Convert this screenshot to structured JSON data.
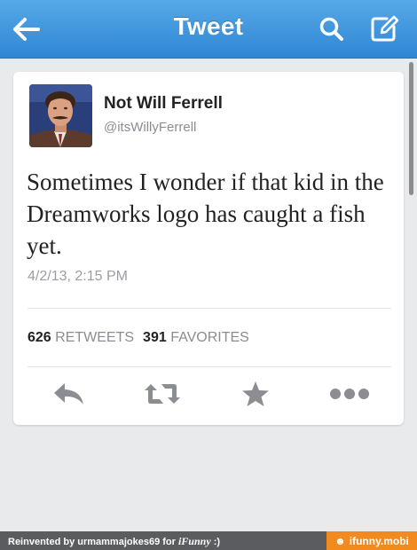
{
  "navbar": {
    "title": "Tweet",
    "back_icon": "back-arrow-icon",
    "search_icon": "search-icon",
    "compose_icon": "compose-icon"
  },
  "tweet": {
    "author_name": "Not Will Ferrell",
    "author_handle": "@itsWillyFerrell",
    "text": "Sometimes I wonder if that kid in the Dreamworks logo has caught a fish yet.",
    "timestamp": "4/2/13, 2:15 PM",
    "retweets_count": "626",
    "retweets_label": "RETWEETS",
    "favorites_count": "391",
    "favorites_label": "FAVORITES"
  },
  "actions": [
    {
      "name": "reply-icon"
    },
    {
      "name": "retweet-icon"
    },
    {
      "name": "favorite-star-icon"
    },
    {
      "name": "more-icon"
    }
  ],
  "footer": {
    "credit_prefix": "Reinvented by urmammajokes69 for ",
    "credit_brand": "iFunny",
    "credit_suffix": " :)",
    "badge": "ifunny.mobi"
  },
  "colors": {
    "navbar_top": "#56a9e8",
    "navbar_bottom": "#2f86d3",
    "background": "#e9eaec",
    "icon_gray": "#8a8d91",
    "footer_orange": "#f28a1d"
  }
}
